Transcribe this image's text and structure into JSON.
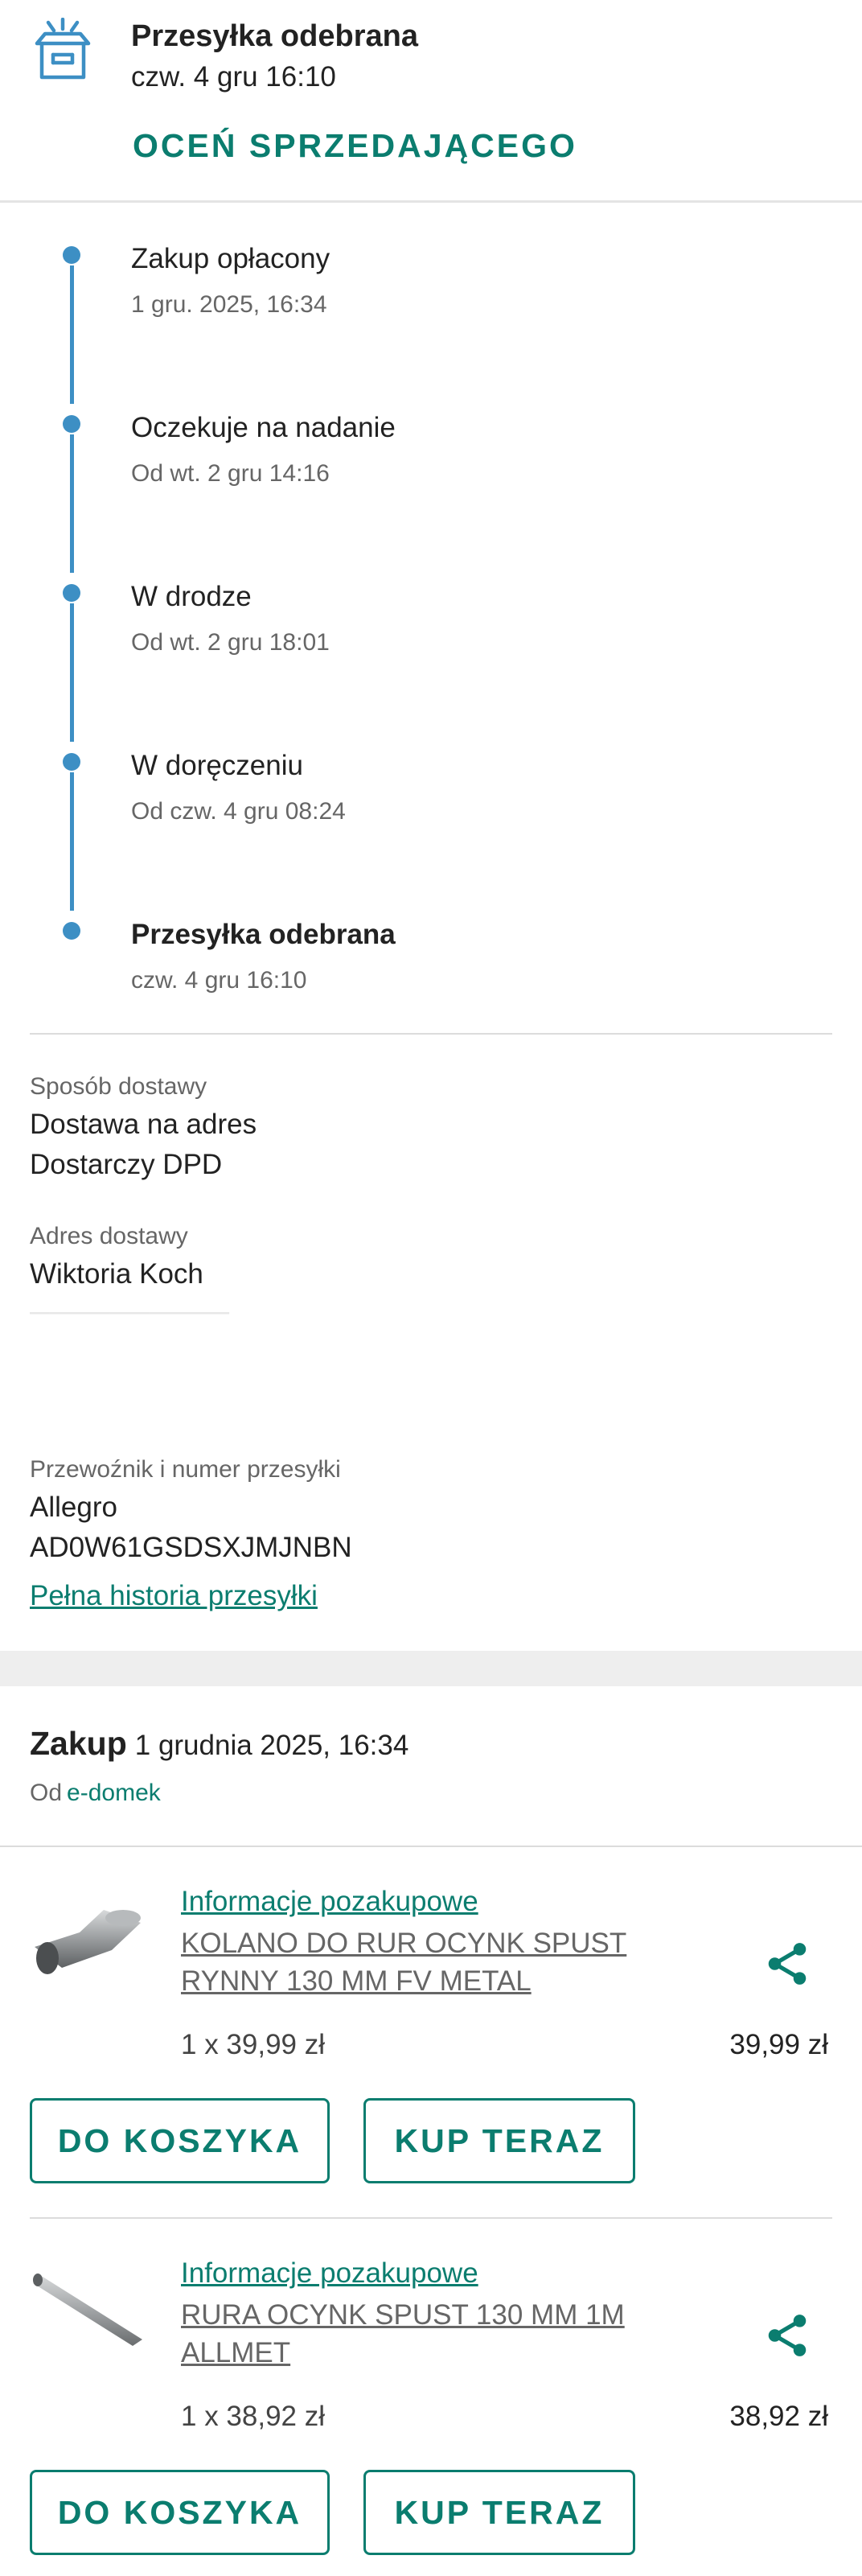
{
  "header": {
    "icon": "package-box-icon",
    "title": "Przesyłka odebrana",
    "subtitle": "czw. 4 gru 16:10",
    "rate_link": "OCEŃ SPRZEDAJĄCEGO"
  },
  "timeline": [
    {
      "title": "Zakup opłacony",
      "date": "1 gru. 2025, 16:34"
    },
    {
      "title": "Oczekuje na nadanie",
      "date": "Od wt. 2 gru 14:16"
    },
    {
      "title": "W drodze",
      "date": "Od wt. 2 gru 18:01"
    },
    {
      "title": "W doręczeniu",
      "date": "Od czw. 4 gru 08:24"
    },
    {
      "title": "Przesyłka odebrana",
      "date": "czw. 4 gru 16:10"
    }
  ],
  "delivery": {
    "method_label": "Sposób dostawy",
    "method": "Dostawa na adres",
    "courier": "Dostarczy DPD",
    "address_label": "Adres dostawy",
    "recipient": "Wiktoria Koch",
    "carrier_label": "Przewoźnik i numer przesyłki",
    "carrier": "Allegro",
    "tracking": "AD0W61GSDSXJMJNBN",
    "history_link": "Pełna historia przesyłki"
  },
  "purchase": {
    "title": "Zakup",
    "date": "1 grudnia 2025, 16:34",
    "from_label": "Od",
    "seller": "e-domek"
  },
  "products": [
    {
      "info_link": "Informacje pozakupowe",
      "name": "KOLANO DO RUR OCYNK SPUST RYNNY 130 MM FV METAL",
      "qty": "1 x 39,99 zł",
      "total": "39,99 zł",
      "cart_button": "DO KOSZYKA",
      "buy_button": "KUP TERAZ"
    },
    {
      "info_link": "Informacje pozakupowe",
      "name": "RURA OCYNK SPUST 130 MM 1M ALLMET",
      "qty": "1 x 38,92 zł",
      "total": "38,92 zł",
      "cart_button": "DO KOSZYKA",
      "buy_button": "KUP TERAZ"
    }
  ],
  "colors": {
    "accent": "#0b7d6f",
    "timeline": "#3d8fc4"
  }
}
